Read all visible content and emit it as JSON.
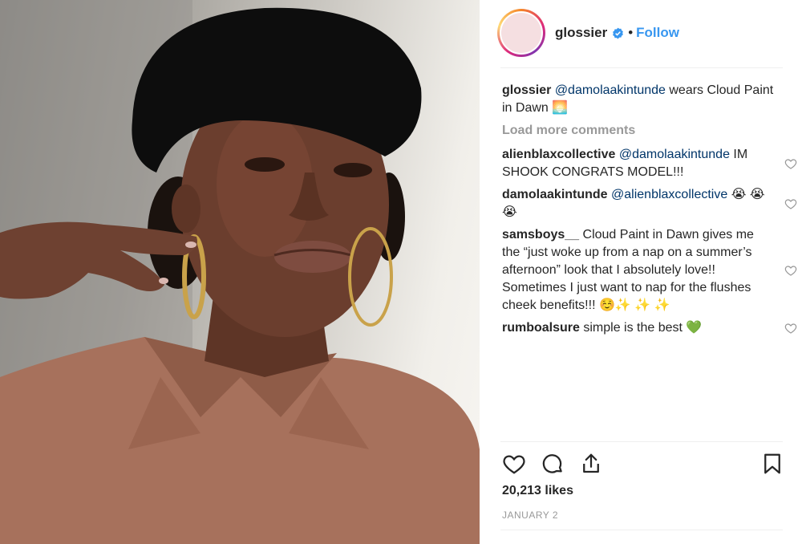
{
  "post": {
    "account": {
      "username": "glossier",
      "verified": true,
      "separator": "•",
      "follow_label": "Follow",
      "avatar_color": "#f5dfe1"
    },
    "caption": {
      "user": "glossier",
      "mention": "@damolaakintunde",
      "text": " wears Cloud Paint in Dawn ",
      "emoji": "🌅"
    },
    "load_more_label": "Load more comments",
    "comments": [
      {
        "user": "alienblaxcollective",
        "mention": "@damolaakintunde",
        "text": "IM SHOOK CONGRATS MODEL!!!"
      },
      {
        "user": "damolaakintunde",
        "mention": "@alienblaxcollective",
        "text": "😭 😭 😭"
      },
      {
        "user": "samsboys__",
        "mention": "",
        "text": "Cloud Paint in Dawn gives me the “just woke up from a nap on a summer’s afternoon” look that I absolutely love!! Sometimes I just want to nap for the flushes cheek benefits!!! ☺️✨ ✨ ✨"
      },
      {
        "user": "rumboalsure",
        "mention": "",
        "text": "simple is the best 💚"
      }
    ],
    "likes_label": "20,213 likes",
    "date_label": "JANUARY 2",
    "icons": {
      "like": "heart-outline-icon",
      "comment": "speech-bubble-icon",
      "share": "share-upload-icon",
      "save": "bookmark-icon",
      "verified": "verified-badge-icon"
    },
    "colors": {
      "link": "#3897f0",
      "mention": "#003569",
      "muted": "#999999",
      "text": "#262626",
      "beret": "#0d0d0d",
      "shirt": "#a7715c",
      "skin": "#6b3e2e",
      "hoop": "#c9a24a"
    }
  }
}
